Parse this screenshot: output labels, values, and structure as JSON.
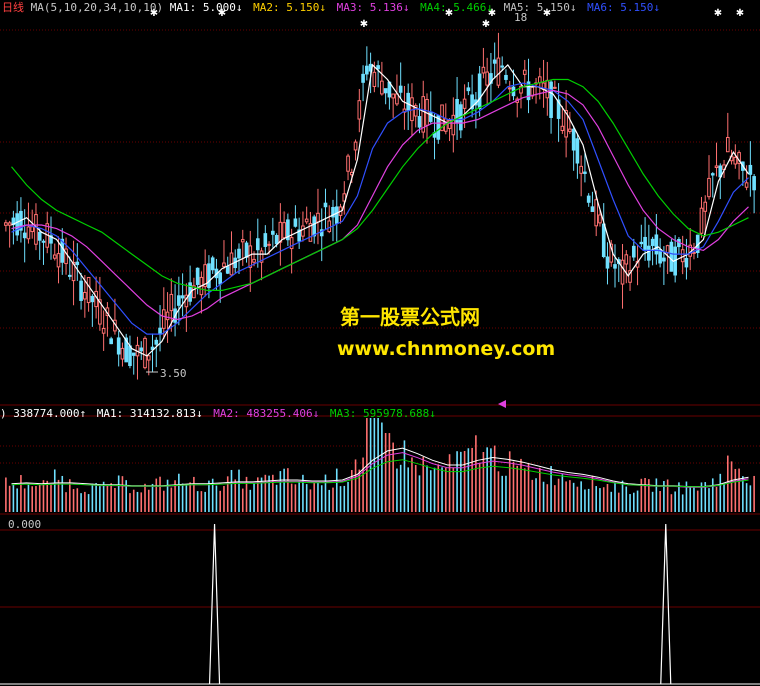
{
  "colors": {
    "background": "#000000",
    "up": "#ff7070",
    "down": "#6fe0ff",
    "ma1": "#ffffff",
    "ma2": "#ffd000",
    "ma3": "#e040e0",
    "ma4": "#00d000",
    "ma5": "#a0a0a0",
    "ma6": "#3050ff",
    "grid": "#6a0000",
    "text": "#c8c8c8",
    "watermark": "#ffe600",
    "period": "#ff4040"
  },
  "price_panel": {
    "period_label": "日线",
    "indicator_name": "MA(5,10,20,34,10,10)",
    "legend": [
      {
        "label": "MA1: 5.000",
        "arrow": "↓",
        "color": "#ffffff"
      },
      {
        "label": "MA2: 5.150",
        "arrow": "↓",
        "color": "#ffd000"
      },
      {
        "label": "MA3: 5.136",
        "arrow": "↓",
        "color": "#e040e0"
      },
      {
        "label": "MA4: 5.466",
        "arrow": "↓",
        "color": "#00d000"
      },
      {
        "label": "MA5: 5.150",
        "arrow": "↓",
        "color": "#c0c0c0"
      },
      {
        "label": "MA6: 5.150",
        "arrow": "↓",
        "color": "#3050ff"
      }
    ],
    "low_label": "3.50",
    "high_label": "18"
  },
  "volume_panel": {
    "legend": [
      {
        "label": ") 338774.000",
        "arrow": "↑",
        "color": "#ffffff"
      },
      {
        "label": "MA1: 314132.813",
        "arrow": "↓",
        "color": "#ffffff"
      },
      {
        "label": "MA2: 483255.406",
        "arrow": "↓",
        "color": "#e040e0"
      },
      {
        "label": "MA3: 595978.688",
        "arrow": "↓",
        "color": "#00d000"
      }
    ]
  },
  "indicator_panel": {
    "label": "0.000"
  },
  "watermark": {
    "line1": "第一股票公式网",
    "line2": "www.chnmoney.com"
  },
  "chart_data": {
    "type": "line",
    "series": [
      {
        "name": "MA1",
        "values": [
          5.4,
          5.5,
          5.3,
          5.2,
          4.9,
          4.6,
          4.3,
          4.0,
          3.7,
          3.6,
          3.8,
          4.2,
          4.5,
          4.6,
          4.8,
          4.9,
          5.0,
          5.0,
          5.2,
          5.3,
          5.4,
          5.5,
          5.6,
          6.3,
          7.6,
          7.4,
          7.1,
          7.0,
          6.9,
          6.8,
          6.9,
          7.1,
          7.4,
          7.6,
          7.3,
          7.3,
          7.2,
          6.9,
          6.5,
          5.7,
          5.0,
          4.7,
          5.0,
          5.1,
          4.9,
          5.0,
          5.2,
          6.0,
          6.4,
          6.1
        ]
      },
      {
        "name": "MA2",
        "values": [
          5.3,
          5.4,
          5.35,
          5.25,
          5.05,
          4.8,
          4.55,
          4.3,
          4.05,
          3.9,
          3.9,
          4.05,
          4.25,
          4.45,
          4.6,
          4.75,
          4.85,
          4.95,
          5.05,
          5.15,
          5.25,
          5.35,
          5.45,
          5.8,
          6.45,
          6.8,
          6.95,
          7.0,
          6.95,
          6.85,
          6.85,
          6.95,
          7.1,
          7.3,
          7.35,
          7.3,
          7.25,
          7.1,
          6.85,
          6.3,
          5.75,
          5.25,
          5.05,
          5.05,
          5.0,
          5.0,
          5.1,
          5.45,
          5.85,
          6.05
        ]
      },
      {
        "name": "MA3",
        "values": [
          5.35,
          5.4,
          5.4,
          5.35,
          5.25,
          5.1,
          4.9,
          4.7,
          4.5,
          4.3,
          4.15,
          4.1,
          4.15,
          4.25,
          4.4,
          4.5,
          4.6,
          4.7,
          4.8,
          4.9,
          5.0,
          5.1,
          5.2,
          5.4,
          5.8,
          6.2,
          6.5,
          6.7,
          6.8,
          6.8,
          6.8,
          6.85,
          6.95,
          7.05,
          7.15,
          7.2,
          7.25,
          7.2,
          7.05,
          6.75,
          6.35,
          5.95,
          5.6,
          5.35,
          5.2,
          5.1,
          5.05,
          5.2,
          5.45,
          5.65
        ]
      },
      {
        "name": "MA4",
        "values": [
          6.2,
          5.95,
          5.75,
          5.6,
          5.5,
          5.4,
          5.3,
          5.15,
          5.0,
          4.85,
          4.7,
          4.6,
          4.55,
          4.5,
          4.5,
          4.55,
          4.6,
          4.7,
          4.8,
          4.9,
          5.0,
          5.1,
          5.2,
          5.35,
          5.6,
          5.9,
          6.2,
          6.45,
          6.65,
          6.8,
          6.9,
          7.0,
          7.1,
          7.2,
          7.3,
          7.35,
          7.4,
          7.4,
          7.3,
          7.1,
          6.8,
          6.45,
          6.1,
          5.8,
          5.55,
          5.35,
          5.25,
          5.3,
          5.4,
          5.5
        ]
      }
    ],
    "ylim": [
      3.2,
      8.3
    ],
    "low_marker": 3.5,
    "volume": [
      0.3,
      0.32,
      0.28,
      0.35,
      0.3,
      0.27,
      0.25,
      0.3,
      0.28,
      0.26,
      0.3,
      0.33,
      0.3,
      0.28,
      0.32,
      0.35,
      0.3,
      0.34,
      0.37,
      0.32,
      0.3,
      0.33,
      0.36,
      0.55,
      0.95,
      0.75,
      0.62,
      0.5,
      0.45,
      0.48,
      0.55,
      0.7,
      0.6,
      0.5,
      0.45,
      0.42,
      0.4,
      0.38,
      0.34,
      0.3,
      0.28,
      0.26,
      0.28,
      0.3,
      0.27,
      0.26,
      0.28,
      0.36,
      0.5,
      0.4
    ],
    "volume_ma": [
      0.3,
      0.31,
      0.3,
      0.31,
      0.31,
      0.3,
      0.29,
      0.29,
      0.28,
      0.28,
      0.28,
      0.29,
      0.3,
      0.3,
      0.31,
      0.32,
      0.32,
      0.33,
      0.34,
      0.34,
      0.33,
      0.33,
      0.34,
      0.4,
      0.55,
      0.65,
      0.68,
      0.62,
      0.55,
      0.5,
      0.5,
      0.55,
      0.58,
      0.56,
      0.53,
      0.49,
      0.45,
      0.42,
      0.4,
      0.37,
      0.33,
      0.3,
      0.29,
      0.28,
      0.28,
      0.27,
      0.27,
      0.29,
      0.34,
      0.37
    ],
    "signal_spikes_x_index": [
      13.5,
      43.5
    ]
  }
}
